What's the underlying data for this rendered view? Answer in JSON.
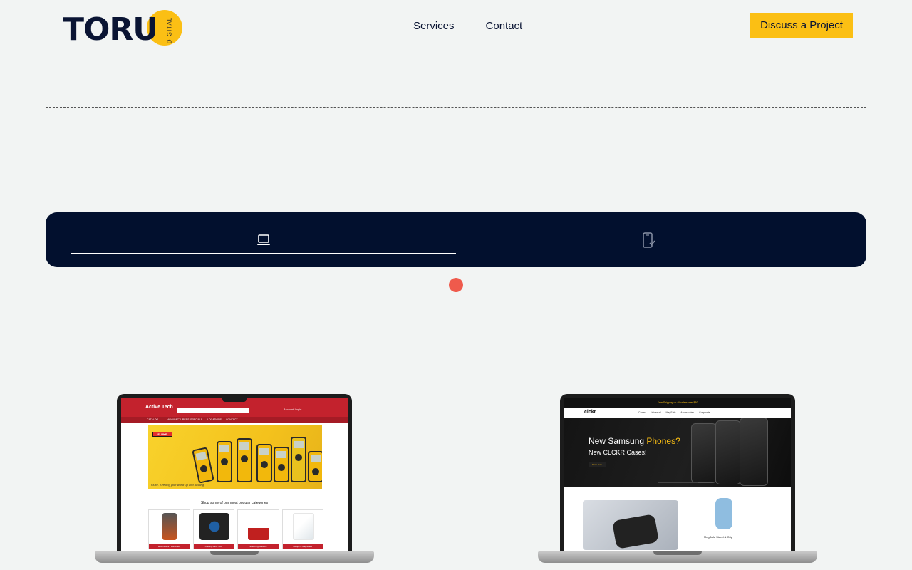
{
  "header": {
    "logo_text": "TORU",
    "logo_sub": "DIGITAL",
    "nav": [
      "Services",
      "Contact"
    ],
    "cta_label": "Discuss a Project"
  },
  "device_tabs": {
    "items": [
      {
        "name": "desktop",
        "icon": "laptop-icon",
        "active": true
      },
      {
        "name": "mobile",
        "icon": "phone-check-icon",
        "active": false
      }
    ]
  },
  "portfolio": {
    "left": {
      "brand": "Active Tech",
      "account_text": "Account  Login",
      "nav_items": [
        "CATALOG",
        "MANUFACTURERS",
        "SPECIALS",
        "LOCATIONS",
        "CONTACT"
      ],
      "banner_badge": "FLUKE",
      "banner_caption": "Fluke. Keeping your world up and running.",
      "categories_heading": "Shop some of our most popular categories",
      "categories": [
        "Multimeters - Handheld",
        "Cooling Fans - AC",
        "Soldering Stations",
        "Lamps & Magnifiers"
      ]
    },
    "right": {
      "topbar": "Free Shipping on all orders over $30",
      "brand": "clckr",
      "nav_links": "Cases  Universal  MagSafe  Accessories  Corporate",
      "hero_title_a": "New Samsung ",
      "hero_title_b": "Phones?",
      "hero_sub": "New CLCKR Cases!",
      "hero_button": "Shop Now",
      "product_label": "MagSafe Stand & Grip"
    }
  },
  "colors": {
    "accent": "#fbbf14",
    "navy": "#02102e",
    "dot": "#ef5a4c",
    "background": "#f2f4f3"
  }
}
